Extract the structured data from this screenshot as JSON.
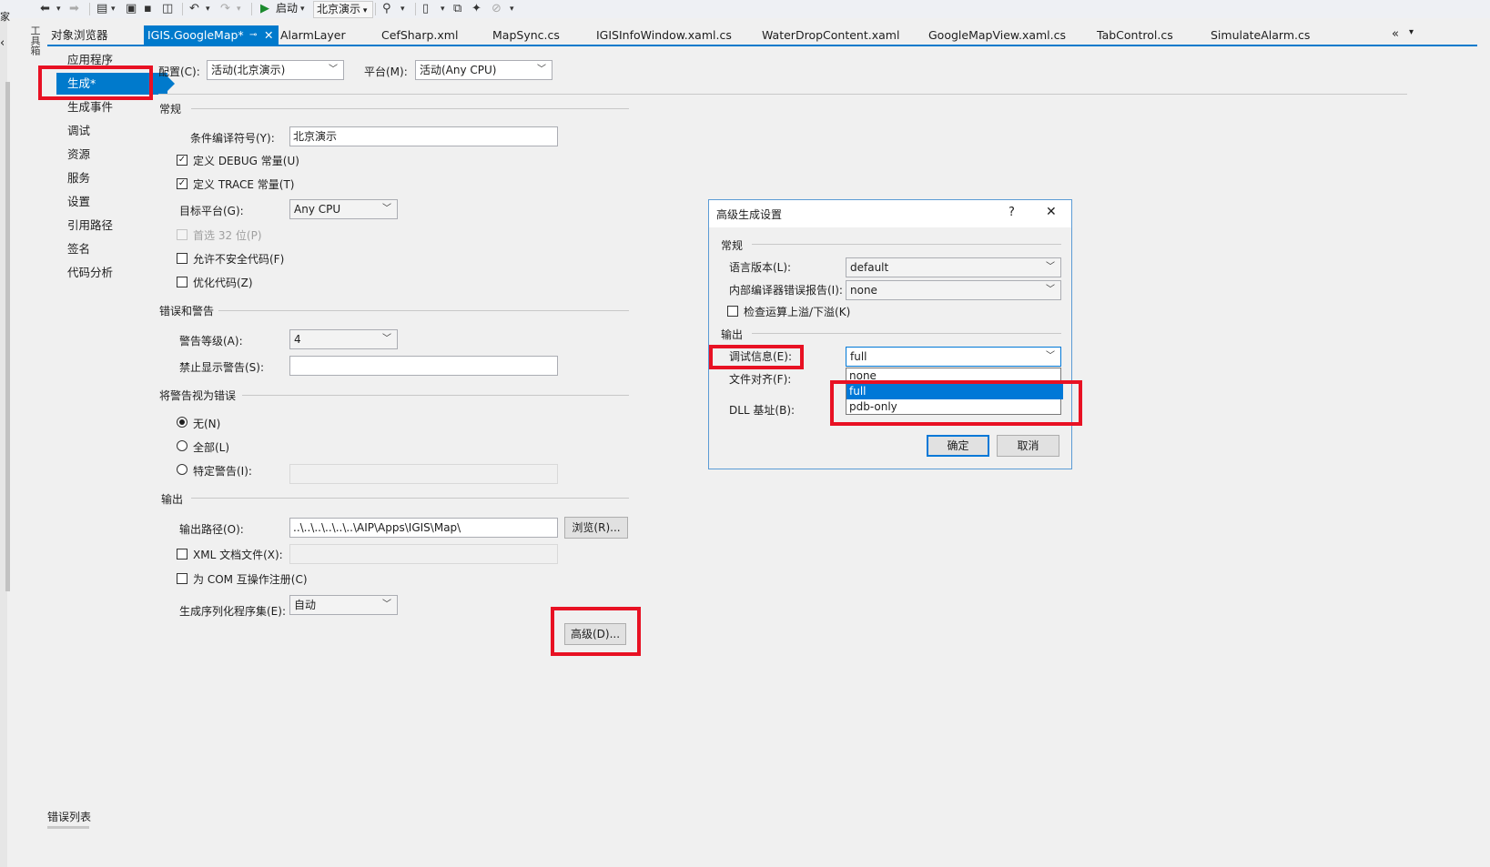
{
  "toolbar": {
    "start_label": "启动",
    "config_label": "北京演示"
  },
  "toolbox_tab": "工具箱",
  "left_strip_text": "家",
  "tabs": [
    {
      "label": "对象浏览器"
    },
    {
      "label": "IGIS.GoogleMap*"
    },
    {
      "label": "AlarmLayer"
    },
    {
      "label": "CefSharp.xml"
    },
    {
      "label": "MapSync.cs"
    },
    {
      "label": "IGISInfoWindow.xaml.cs"
    },
    {
      "label": "WaterDropContent.xaml"
    },
    {
      "label": "GoogleMapView.xaml.cs"
    },
    {
      "label": "TabControl.cs"
    },
    {
      "label": "SimulateAlarm.cs"
    }
  ],
  "nav": {
    "items": [
      "应用程序",
      "生成*",
      "生成事件",
      "调试",
      "资源",
      "服务",
      "设置",
      "引用路径",
      "签名",
      "代码分析"
    ],
    "selected_index": 1
  },
  "top": {
    "config_label": "配置(C):",
    "config_value": "活动(北京演示)",
    "platform_label": "平台(M):",
    "platform_value": "活动(Any CPU)"
  },
  "general": {
    "section": "常规",
    "symbols_label": "条件编译符号(Y):",
    "symbols_value": "北京演示",
    "debug_label": "定义 DEBUG 常量(U)",
    "debug_checked": true,
    "trace_label": "定义 TRACE 常量(T)",
    "trace_checked": true,
    "target_label": "目标平台(G):",
    "target_value": "Any CPU",
    "prefer32_label": "首选 32 位(P)",
    "unsafe_label": "允许不安全代码(F)",
    "optimize_label": "优化代码(Z)"
  },
  "errors": {
    "section": "错误和警告",
    "level_label": "警告等级(A):",
    "level_value": "4",
    "suppress_label": "禁止显示警告(S):",
    "suppress_value": ""
  },
  "treat": {
    "section": "将警告视为错误",
    "none_label": "无(N)",
    "all_label": "全部(L)",
    "specific_label": "特定警告(I):",
    "selected": "none"
  },
  "output": {
    "section": "输出",
    "path_label": "输出路径(O):",
    "path_value": "..\\..\\..\\..\\..\\..\\AIP\\Apps\\IGIS\\Map\\",
    "browse_label": "浏览(R)...",
    "xml_label": "XML 文档文件(X):",
    "com_label": "为 COM 互操作注册(C)",
    "serial_label": "生成序列化程序集(E):",
    "serial_value": "自动",
    "advanced_label": "高级(D)..."
  },
  "dialog": {
    "title": "高级生成设置",
    "help": "?",
    "close": "✕",
    "general_section": "常规",
    "lang_label": "语言版本(L):",
    "lang_value": "default",
    "report_label": "内部编译器错误报告(I):",
    "report_value": "none",
    "overflow_label": "检查运算上溢/下溢(K)",
    "output_section": "输出",
    "debuginfo_label": "调试信息(E):",
    "debuginfo_value": "full",
    "align_label": "文件对齐(F):",
    "dll_label": "DLL 基址(B):",
    "options": [
      "none",
      "full",
      "pdb-only"
    ],
    "highlighted_option": 1,
    "ok_label": "确定",
    "cancel_label": "取消"
  },
  "bottom_tab": "错误列表",
  "colors": {
    "accent": "#007acc",
    "highlight_box": "#e81123",
    "selection": "#0078d7"
  }
}
